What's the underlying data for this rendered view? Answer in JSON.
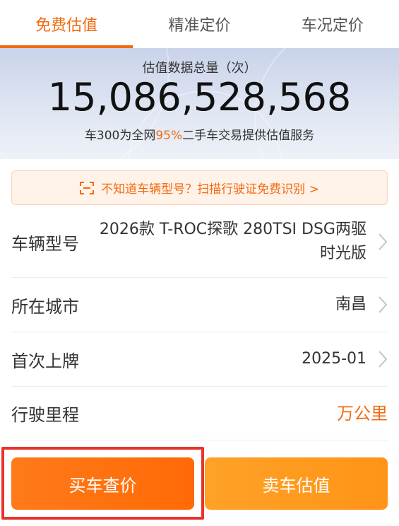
{
  "tabs": [
    {
      "label": "免费估值",
      "active": true
    },
    {
      "label": "精准定价",
      "active": false
    },
    {
      "label": "车况定价",
      "active": false
    }
  ],
  "banner": {
    "caption": "估值数据总量（次）",
    "total": "15,086,528,568",
    "sub_before": "车300为全网",
    "sub_percent": "95%",
    "sub_after": "二手车交易提供估值服务"
  },
  "tip": {
    "icon": "scan-icon",
    "text": "不知道车辆型号？扫描行驶证免费识别 >"
  },
  "form": {
    "model": {
      "label": "车辆型号",
      "value": "2026款 T-ROC探歌 280TSI DSG两驱时光版"
    },
    "city": {
      "label": "所在城市",
      "value": "南昌"
    },
    "date": {
      "label": "首次上牌",
      "value": "2025-01"
    },
    "mileage": {
      "label": "行驶里程",
      "unit": "万公里"
    }
  },
  "buttons": {
    "buy": "买车查价",
    "sell": "卖车估值"
  },
  "colors": {
    "accent": "#f26b12",
    "highlight": "#e8342b",
    "sell_button": "#ff9a1f"
  }
}
